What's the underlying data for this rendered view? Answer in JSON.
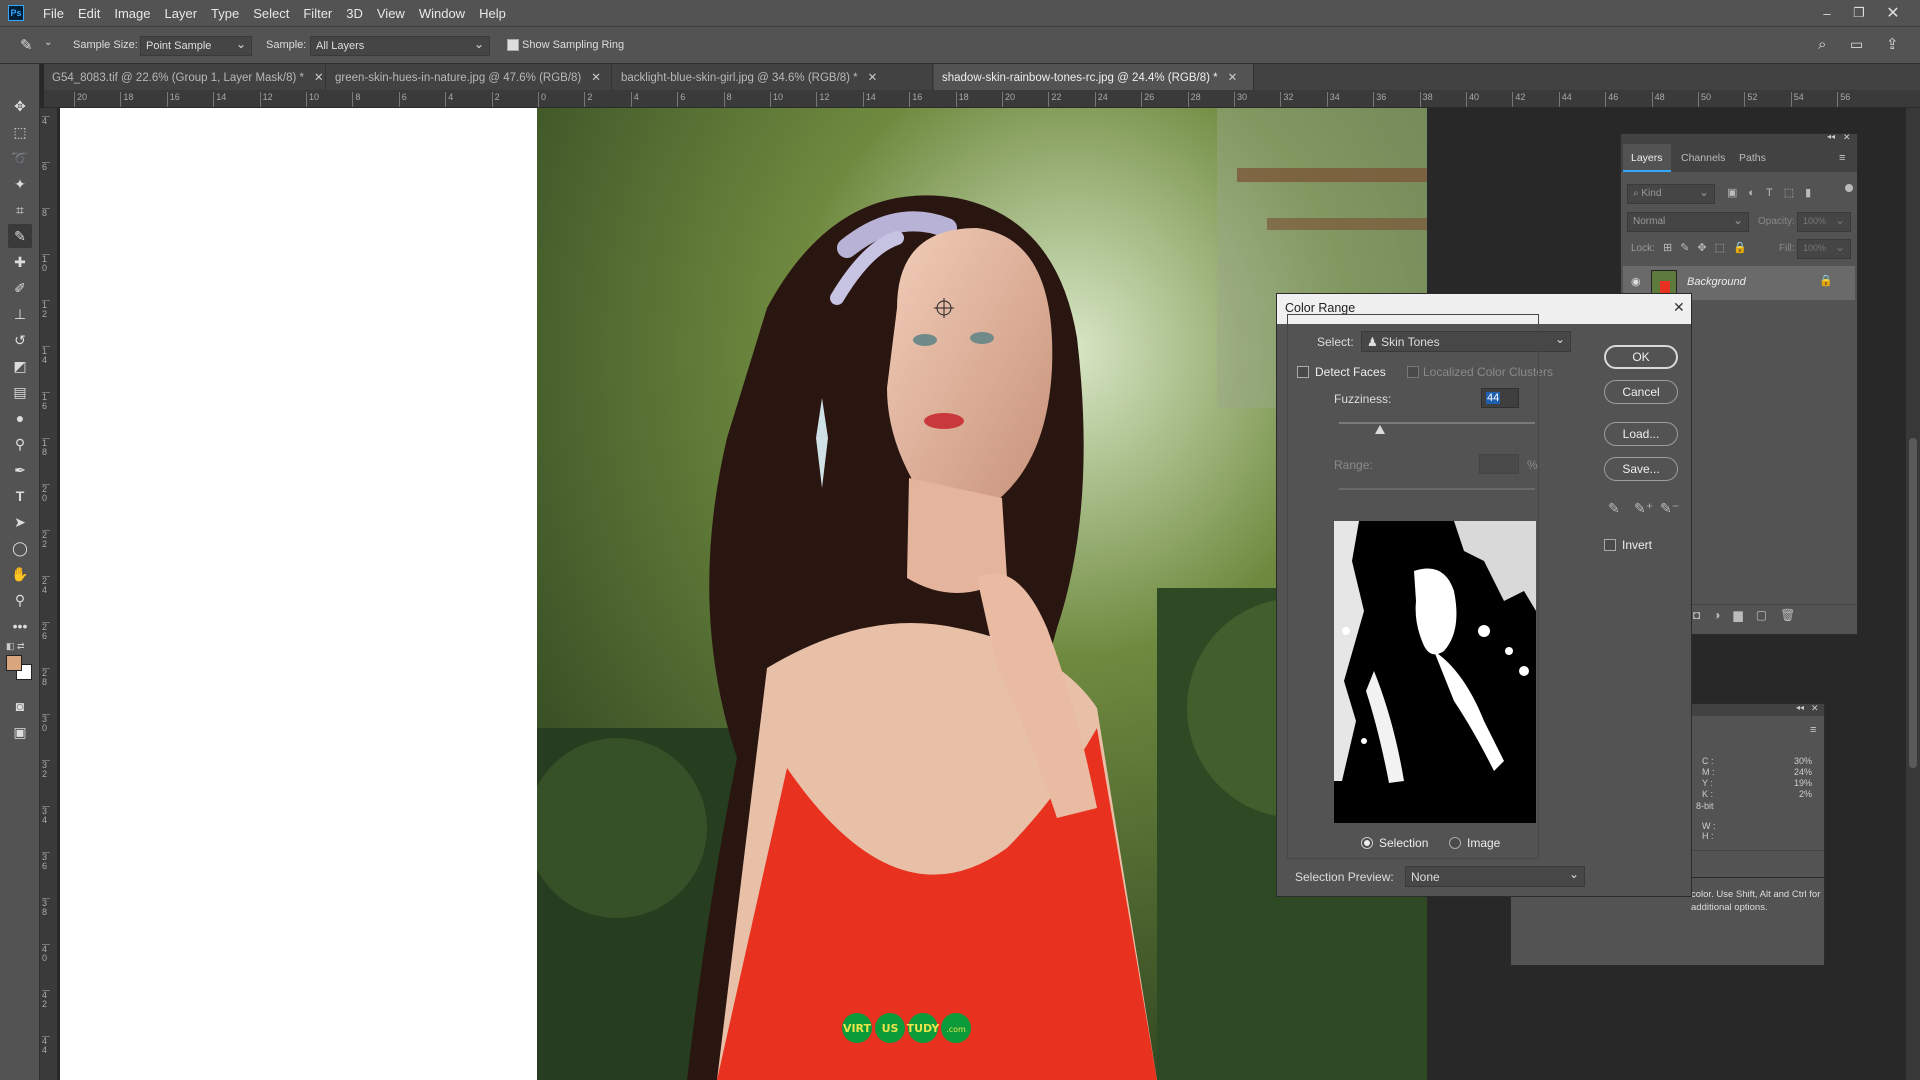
{
  "app": {
    "logo": "Ps"
  },
  "menu": [
    "File",
    "Edit",
    "Image",
    "Layer",
    "Type",
    "Select",
    "Filter",
    "3D",
    "View",
    "Window",
    "Help"
  ],
  "options": {
    "sample_size_label": "Sample Size:",
    "sample_size_value": "Point Sample",
    "sample_label": "Sample:",
    "sample_value": "All Layers",
    "show_ring_label": "Show Sampling Ring"
  },
  "tabs": [
    {
      "label": "G54_8083.tif @ 22.6% (Group 1, Layer Mask/8) *"
    },
    {
      "label": "green-skin-hues-in-nature.jpg @ 47.6% (RGB/8)"
    },
    {
      "label": "backlight-blue-skin-girl.jpg @ 34.6% (RGB/8) *"
    },
    {
      "label": "shadow-skin-rainbow-tones-rc.jpg @ 24.4% (RGB/8) *"
    }
  ],
  "hruler_labels": [
    "20",
    "18",
    "16",
    "14",
    "12",
    "10",
    "8",
    "6",
    "4",
    "2",
    "0",
    "2",
    "4",
    "6",
    "8",
    "10",
    "12",
    "14",
    "16",
    "18",
    "20",
    "22",
    "24",
    "26",
    "28",
    "30",
    "32",
    "34",
    "36",
    "38",
    "40",
    "42",
    "44",
    "46",
    "48",
    "50",
    "52",
    "54",
    "56"
  ],
  "vruler_labels": [
    "4",
    "6",
    "8",
    "1 0",
    "1 2",
    "1 4",
    "1 6",
    "1 8",
    "2 0",
    "2 2",
    "2 4",
    "2 6",
    "2 8",
    "3 0",
    "3 2",
    "3 4",
    "3 6",
    "3 8",
    "4 0",
    "4 2",
    "4 4"
  ],
  "layers_panel": {
    "tabs": [
      "Layers",
      "Channels",
      "Paths"
    ],
    "kind_label": "Kind",
    "blend_mode": "Normal",
    "opacity_label": "Opacity:",
    "opacity_value": "100%",
    "lock_label": "Lock:",
    "fill_label": "Fill:",
    "fill_value": "100%",
    "layer_name": "Background"
  },
  "info_panel": {
    "cmyk": [
      {
        "k": "C :",
        "v": "30%"
      },
      {
        "k": "M :",
        "v": "24%"
      },
      {
        "k": "Y :",
        "v": "19%"
      },
      {
        "k": "K :",
        "v": "2%"
      }
    ],
    "bitdepth": "8-bit",
    "w_label": "W :",
    "h_label": "H :",
    "hint": "color.  Use Shift, Alt and Ctrl for additional options."
  },
  "color_range": {
    "title": "Color Range",
    "select_label": "Select:",
    "select_value": "Skin Tones",
    "detect_faces": "Detect Faces",
    "localized": "Localized Color Clusters",
    "fuzziness_label": "Fuzziness:",
    "fuzziness_value": "44",
    "fuzziness_level": 0.21,
    "range_label": "Range:",
    "range_unit": "%",
    "ok": "OK",
    "cancel": "Cancel",
    "load": "Load...",
    "save": "Save...",
    "invert": "Invert",
    "radio_selection": "Selection",
    "radio_image": "Image",
    "preview_label": "Selection Preview:",
    "preview_value": "None"
  },
  "watermark": [
    "VIRT",
    "US",
    "TUDY",
    ".com"
  ],
  "colors": {
    "accent": "#31a8ff",
    "dress": "#e8321f",
    "foreground_swatch": "#d9a57c"
  }
}
